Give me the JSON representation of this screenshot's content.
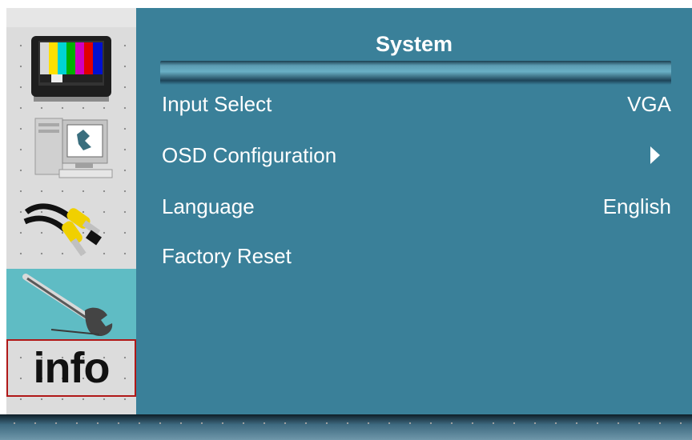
{
  "menu": {
    "title": "System",
    "rows": [
      {
        "label": "Input Select",
        "value": "VGA"
      },
      {
        "label": "OSD Configuration",
        "value": ""
      },
      {
        "label": "Language",
        "value": "English"
      },
      {
        "label": "Factory Reset",
        "value": ""
      }
    ]
  },
  "sidebar": {
    "items": [
      {
        "icon": "tv-color-bars-icon"
      },
      {
        "icon": "computer-icon"
      },
      {
        "icon": "av-cables-icon"
      },
      {
        "icon": "wrench-icon",
        "selected": true
      },
      {
        "icon": "info-icon",
        "text": "info"
      }
    ]
  },
  "colors": {
    "panel": "#3a8099",
    "selected_tab": "#5fbcc4",
    "sidebar": "#dcdcdc",
    "text": "#ffffff"
  }
}
